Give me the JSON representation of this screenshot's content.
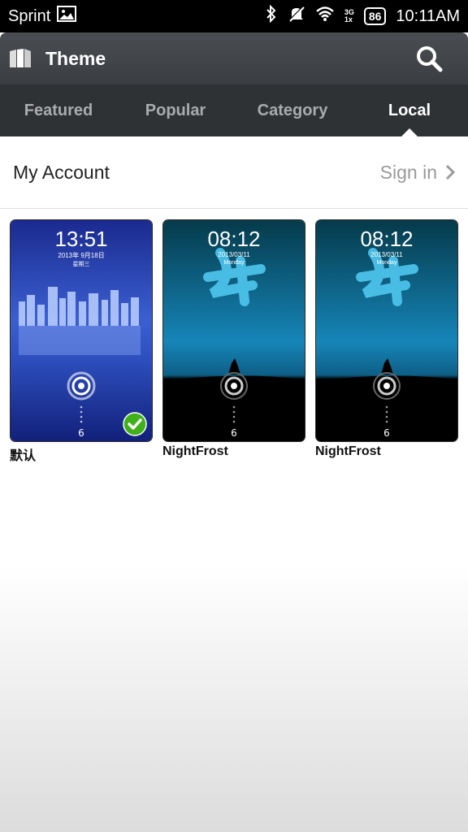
{
  "status_bar": {
    "carrier": "Sprint",
    "network_top": "3G",
    "network_bottom": "1x",
    "battery": "86",
    "time": "10:11AM"
  },
  "header": {
    "title": "Theme"
  },
  "tabs": [
    {
      "label": "Featured",
      "active": false
    },
    {
      "label": "Popular",
      "active": false
    },
    {
      "label": "Category",
      "active": false
    },
    {
      "label": "Local",
      "active": true
    }
  ],
  "account": {
    "label": "My Account",
    "action": "Sign in"
  },
  "themes": [
    {
      "name": "默认",
      "clock": "13:51",
      "date": "2013年 9月18日",
      "weekday": "星期三",
      "applied": true
    },
    {
      "name": "NightFrost",
      "clock": "08:12",
      "date": "2013/03/11",
      "weekday": "Monday",
      "applied": false
    },
    {
      "name": "NightFrost",
      "clock": "08:12",
      "date": "2013/03/11",
      "weekday": "Monday",
      "applied": false
    }
  ],
  "colors": {
    "header": "#3f4246",
    "tabs": "#2f3235",
    "accent_check": "#3fb01a"
  }
}
